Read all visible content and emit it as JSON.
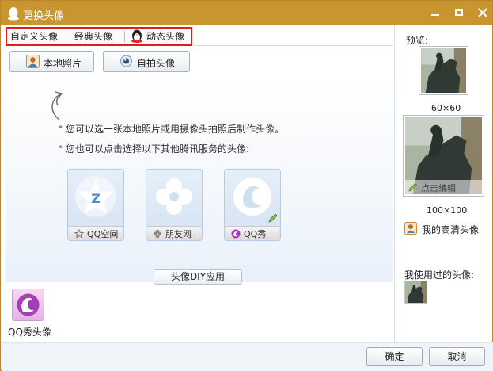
{
  "window": {
    "title": "更换头像",
    "accent_color": "#c9952e",
    "controls": [
      "minimize-icon",
      "maximize-icon",
      "close-icon"
    ]
  },
  "tabs": [
    {
      "label": "自定义头像",
      "active": true
    },
    {
      "label": "经典头像",
      "active": false
    },
    {
      "label": "动态头像",
      "active": false,
      "icon": "penguin-icon"
    }
  ],
  "actions": {
    "local_photo": {
      "label": "本地照片",
      "icon": "user-photo-icon"
    },
    "selfie": {
      "label": "自拍头像",
      "icon": "webcam-icon"
    }
  },
  "tips": [
    "您可以选一张本地照片或用摄像头拍照后制作头像。",
    "您也可以点击选择以下其他腾讯服务的头像:"
  ],
  "services": [
    {
      "label": "QQ空间",
      "icon": "qzone-star-icon"
    },
    {
      "label": "朋友网",
      "icon": "flower-icon"
    },
    {
      "label": "QQ秀",
      "icon": "qqshow-icon"
    }
  ],
  "diy_app_label": "头像DIY应用",
  "apps": [
    {
      "label": "QQ秀头像",
      "icon": "qqshow-icon"
    }
  ],
  "preview": {
    "label": "预览:",
    "small_caption": "60×60",
    "large_caption": "100×100",
    "edit_label": "点击编辑",
    "hd_label": "我的高清头像",
    "used_label": "我使用过的头像:"
  },
  "dialog_buttons": {
    "ok": "确定",
    "cancel": "取消"
  }
}
